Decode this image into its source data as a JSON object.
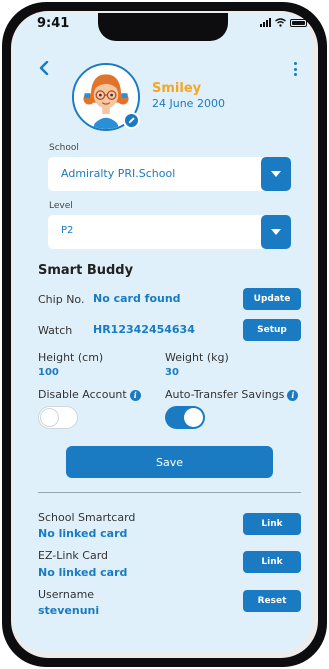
{
  "status_bar": {
    "time": "9:41"
  },
  "colors": {
    "accent": "#1a7bc2",
    "name": "#f5a623",
    "screen_bg": "#dff0fa"
  },
  "profile": {
    "name": "Smiley",
    "dob": "24 June 2000"
  },
  "school": {
    "label": "School",
    "value": "Admiralty PRI.School"
  },
  "level": {
    "label": "Level",
    "value": "P2"
  },
  "smart_buddy": {
    "title": "Smart Buddy",
    "chip_label": "Chip No.",
    "chip_value": "No card found",
    "update_label": "Update",
    "watch_label": "Watch",
    "watch_value": "HR12342454634",
    "setup_label": "Setup",
    "height_label": "Height (cm)",
    "height_value": "100",
    "weight_label": "Weight (kg)",
    "weight_value": "30",
    "disable_label": "Disable Account",
    "disable_on": false,
    "auto_transfer_label": "Auto-Transfer Savings",
    "auto_transfer_on": true
  },
  "save_label": "Save",
  "cards": {
    "smartcard_label": "School Smartcard",
    "smartcard_value": "No linked card",
    "smartcard_button": "Link",
    "ezlink_label": "EZ-Link Card",
    "ezlink_value": "No linked card",
    "ezlink_button": "Link",
    "username_label": "Username",
    "username_value": "stevenuni",
    "reset_button": "Reset"
  }
}
